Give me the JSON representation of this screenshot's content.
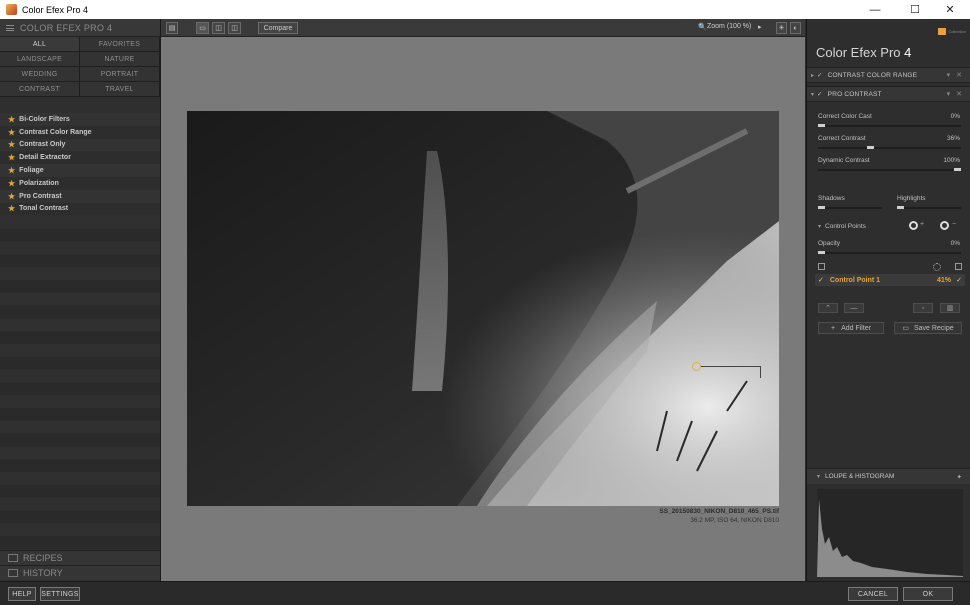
{
  "window": {
    "title": "Color Efex Pro 4",
    "minimize_glyph": "—",
    "maximize_glyph": "☐",
    "close_glyph": "✕"
  },
  "left_panel": {
    "header": "COLOR EFEX PRO 4",
    "categories": [
      "ALL",
      "FAVORITES",
      "LANDSCAPE",
      "NATURE",
      "WEDDING",
      "PORTRAIT",
      "CONTRAST",
      "TRAVEL"
    ],
    "filters": [
      "Bi-Color Filters",
      "Contrast Color Range",
      "Contrast Only",
      "Detail Extractor",
      "Foliage",
      "Polarization",
      "Pro Contrast",
      "Tonal Contrast"
    ],
    "recipes_label": "RECIPES",
    "history_label": "HISTORY"
  },
  "toolbar": {
    "compare_label": "Compare",
    "zoom_label": "Zoom (100 %)",
    "zoom_arrow": "▸"
  },
  "image": {
    "filename": "SS_20150830_NIKON_D810_465_PS.tif",
    "info": "36.2 MP, ISO 64, NIKON D810"
  },
  "right_panel": {
    "brand_title": "Color Efex Pro",
    "brand_version": "4",
    "logo_text": "Collection",
    "filter_stack": [
      {
        "name": "CONTRAST COLOR RANGE",
        "checked": true
      },
      {
        "name": "PRO CONTRAST",
        "checked": true
      }
    ],
    "sliders": {
      "correct_color_cast": {
        "label": "Correct Color Cast",
        "value": "0%",
        "level": 0.0
      },
      "correct_contrast": {
        "label": "Correct Contrast",
        "value": "36%",
        "level": 0.36
      },
      "dynamic_contrast": {
        "label": "Dynamic Contrast",
        "value": "100%",
        "level": 1.0
      },
      "shadows": {
        "label": "Shadows",
        "level": 0.0
      },
      "highlights": {
        "label": "Highlights",
        "level": 0.0
      },
      "opacity": {
        "label": "Opacity",
        "value": "0%",
        "level": 0.0
      }
    },
    "control_points_label": "Control Points",
    "control_point": {
      "name": "Control Point 1",
      "value": "41%"
    },
    "add_filter_label": "Add Filter",
    "save_recipe_label": "Save Recipe",
    "loupe_label": "LOUPE & HISTOGRAM"
  },
  "bottom_bar": {
    "help_label": "HELP",
    "settings_label": "SETTINGS",
    "cancel_label": "CANCEL",
    "ok_label": "OK"
  },
  "colors": {
    "accent": "#e4a338",
    "star": "#d8a93a",
    "panel": "#2e2e2e",
    "canvas": "#7a7a7a"
  }
}
